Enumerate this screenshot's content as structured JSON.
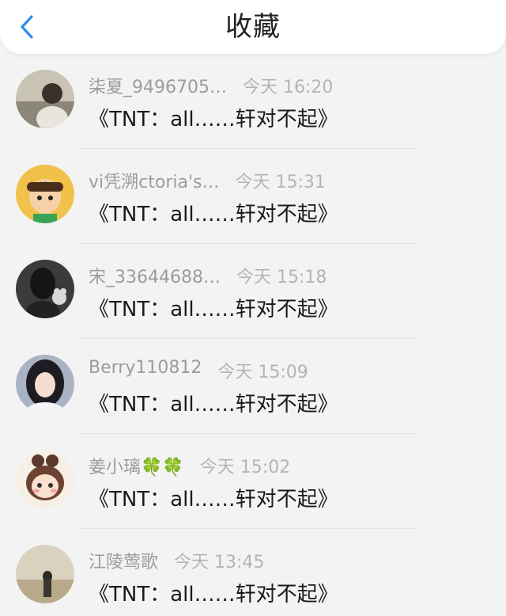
{
  "header": {
    "title": "收藏",
    "back_icon": "chevron-left-icon",
    "accent": "#2f8cf0"
  },
  "items": [
    {
      "name": "柒夏_9496705…",
      "time": "今天 16:20",
      "title": "《TNT：all……轩对不起》",
      "avatar_icon": "portrait-avatar-icon"
    },
    {
      "name": "vi凭溯ctoria's…",
      "time": "今天 15:31",
      "title": "《TNT：all……轩对不起》",
      "avatar_icon": "cartoon-boy-avatar-icon"
    },
    {
      "name": "宋_33644688…",
      "time": "今天 15:18",
      "title": "《TNT：all……轩对不起》",
      "avatar_icon": "dark-portrait-avatar-icon"
    },
    {
      "name": "Berry110812",
      "time": "今天 15:09",
      "title": "《TNT：all……轩对不起》",
      "avatar_icon": "girl-portrait-avatar-icon"
    },
    {
      "name": "姜小璃🍀🍀",
      "time": "今天 15:02",
      "title": "《TNT：all……轩对不起》",
      "avatar_icon": "cartoon-girl-avatar-icon"
    },
    {
      "name": "江陵莺歌",
      "time": "今天 13:45",
      "title": "《TNT：all……轩对不起》",
      "avatar_icon": "landscape-avatar-icon"
    }
  ]
}
